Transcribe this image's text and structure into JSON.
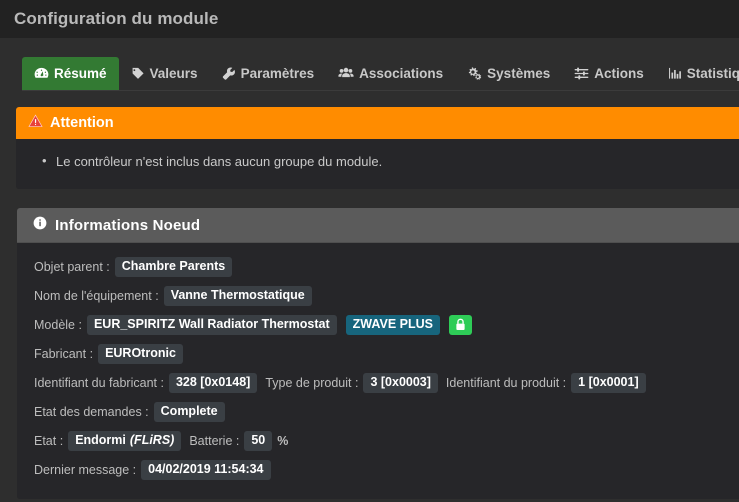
{
  "window": {
    "title": "Configuration du module"
  },
  "tabs": [
    {
      "label": "Résumé",
      "icon": "dashboard-icon",
      "active": true
    },
    {
      "label": "Valeurs",
      "icon": "tag-icon",
      "active": false
    },
    {
      "label": "Paramètres",
      "icon": "wrench-icon",
      "active": false
    },
    {
      "label": "Associations",
      "icon": "users-icon",
      "active": false
    },
    {
      "label": "Systèmes",
      "icon": "cogs-icon",
      "active": false
    },
    {
      "label": "Actions",
      "icon": "sliders-icon",
      "active": false
    },
    {
      "label": "Statistiques",
      "icon": "bar-chart-icon",
      "active": false
    }
  ],
  "alert": {
    "icon": "warning-triangle-icon",
    "title": "Attention",
    "items": [
      "Le contrôleur n'est inclus dans aucun groupe du module."
    ],
    "header_color": "#ff8c00"
  },
  "panel": {
    "icon": "info-circle-icon",
    "title": "Informations Noeud",
    "rows": {
      "parent_object": {
        "label": "Objet parent :",
        "value": "Chambre Parents"
      },
      "equipment_name": {
        "label": "Nom de l'équipement :",
        "value": "Vanne Thermostatique"
      },
      "model": {
        "label": "Modèle :",
        "value": "EUR_SPIRITZ Wall Radiator Thermostat",
        "zwave_badge": "ZWAVE PLUS",
        "lock_icon": "lock-icon"
      },
      "manufacturer": {
        "label": "Fabricant :",
        "value": "EUROtronic"
      },
      "manufacturer_id": {
        "label": "Identifiant du fabricant :",
        "value": "328 [0x0148]"
      },
      "product_type": {
        "label": "Type de produit :",
        "value": "3 [0x0003]"
      },
      "product_id": {
        "label": "Identifiant du produit :",
        "value": "1 [0x0001]"
      },
      "request_state": {
        "label": "Etat des demandes :",
        "value": "Complete"
      },
      "state": {
        "label": "Etat :",
        "value": "Endormi",
        "value_sub": "(FLiRS)"
      },
      "battery": {
        "label": "Batterie :",
        "value": "50",
        "unit": "%"
      },
      "last_message": {
        "label": "Dernier message :",
        "value": "04/02/2019 11:54:34"
      }
    }
  },
  "colors": {
    "accent_green": "#337a33",
    "warning_orange": "#ff8c00",
    "zwave_teal": "#17657d",
    "lock_green": "#2ecc57",
    "badge_bg": "#3a3f44",
    "panel_header": "#5b5b5b"
  }
}
